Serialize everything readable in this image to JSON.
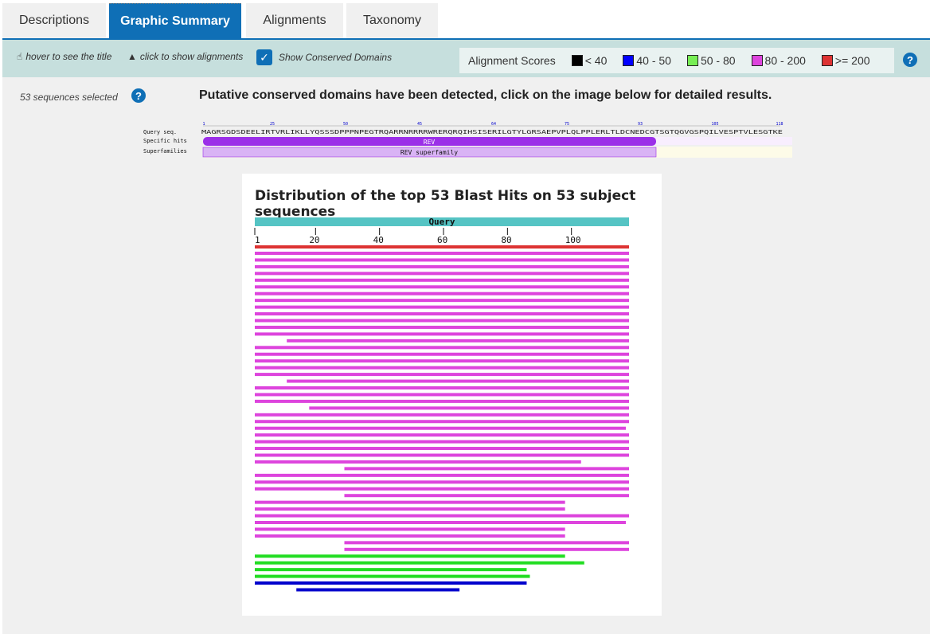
{
  "tabs": [
    "Descriptions",
    "Graphic Summary",
    "Alignments",
    "Taxonomy"
  ],
  "toolbar": {
    "hover_text": "hover to see the title",
    "click_text": "click to show alignments",
    "conserved_label": "Show Conserved Domains",
    "scores_label": "Alignment Scores",
    "score_bins": [
      {
        "label": "< 40",
        "color": "#000000"
      },
      {
        "label": "40 - 50",
        "color": "#0000ff"
      },
      {
        "label": "50 - 80",
        "color": "#77ee55"
      },
      {
        "label": "80 - 200",
        "color": "#dd44dd"
      },
      {
        "label": ">= 200",
        "color": "#dd3333"
      }
    ]
  },
  "selection": {
    "text": "53 sequences selected"
  },
  "message": "Putative conserved domains have been detected, click on the image below for detailed results.",
  "cdd": {
    "query_label": "Query seq.",
    "specific_label": "Specific hits",
    "super_label": "Superfamilies",
    "sequence": "MAGRSGDSDEELIRTVRLIKLLYQSSSDPPPNPEGTRQARRNRRRRWRERQRQIHSISERILGTYLGRSAEPVPLQLPPLERLTLDCNEDCGTSGTQGVGSPQILVESPTVLESGTKE",
    "ticks": [
      "1",
      "25",
      "50",
      "45",
      "64",
      "75",
      "93",
      "105",
      "118"
    ],
    "specific_hit": "REV",
    "superfamily": "REV superfamily"
  },
  "summary": {
    "title": "Distribution of the top 53 Blast Hits on 53 subject sequences",
    "query_label": "Query",
    "axis_ticks": [
      "1",
      "20",
      "40",
      "60",
      "80",
      "100"
    ]
  },
  "colors": {
    "accent": "#0f6fb6",
    "query_bar": "#55c4c4"
  },
  "hits": [
    {
      "s": 1,
      "e": 118,
      "c": "#dd3333"
    },
    {
      "s": 1,
      "e": 118,
      "c": "#dd44dd"
    },
    {
      "s": 1,
      "e": 118,
      "c": "#dd44dd"
    },
    {
      "s": 1,
      "e": 118,
      "c": "#dd44dd"
    },
    {
      "s": 1,
      "e": 118,
      "c": "#dd44dd"
    },
    {
      "s": 1,
      "e": 118,
      "c": "#dd44dd"
    },
    {
      "s": 1,
      "e": 118,
      "c": "#dd44dd"
    },
    {
      "s": 1,
      "e": 118,
      "c": "#dd44dd"
    },
    {
      "s": 1,
      "e": 118,
      "c": "#dd44dd"
    },
    {
      "s": 1,
      "e": 118,
      "c": "#dd44dd"
    },
    {
      "s": 1,
      "e": 118,
      "c": "#dd44dd"
    },
    {
      "s": 1,
      "e": 118,
      "c": "#dd44dd"
    },
    {
      "s": 1,
      "e": 118,
      "c": "#dd44dd"
    },
    {
      "s": 1,
      "e": 118,
      "c": "#dd44dd"
    },
    {
      "s": 11,
      "e": 118,
      "c": "#dd44dd"
    },
    {
      "s": 1,
      "e": 118,
      "c": "#dd44dd"
    },
    {
      "s": 1,
      "e": 118,
      "c": "#dd44dd"
    },
    {
      "s": 1,
      "e": 118,
      "c": "#dd44dd"
    },
    {
      "s": 1,
      "e": 118,
      "c": "#dd44dd"
    },
    {
      "s": 1,
      "e": 118,
      "c": "#dd44dd"
    },
    {
      "s": 11,
      "e": 118,
      "c": "#dd44dd"
    },
    {
      "s": 1,
      "e": 118,
      "c": "#dd44dd"
    },
    {
      "s": 1,
      "e": 118,
      "c": "#dd44dd"
    },
    {
      "s": 1,
      "e": 118,
      "c": "#dd44dd"
    },
    {
      "s": 18,
      "e": 118,
      "c": "#dd44dd"
    },
    {
      "s": 1,
      "e": 118,
      "c": "#dd44dd"
    },
    {
      "s": 1,
      "e": 118,
      "c": "#dd44dd"
    },
    {
      "s": 1,
      "e": 117,
      "c": "#dd44dd"
    },
    {
      "s": 1,
      "e": 118,
      "c": "#dd44dd"
    },
    {
      "s": 1,
      "e": 118,
      "c": "#dd44dd"
    },
    {
      "s": 1,
      "e": 118,
      "c": "#dd44dd"
    },
    {
      "s": 1,
      "e": 118,
      "c": "#dd44dd"
    },
    {
      "s": 1,
      "e": 103,
      "c": "#dd44dd"
    },
    {
      "s": 29,
      "e": 118,
      "c": "#dd44dd"
    },
    {
      "s": 1,
      "e": 118,
      "c": "#dd44dd"
    },
    {
      "s": 1,
      "e": 118,
      "c": "#dd44dd"
    },
    {
      "s": 1,
      "e": 118,
      "c": "#dd44dd"
    },
    {
      "s": 29,
      "e": 118,
      "c": "#dd44dd"
    },
    {
      "s": 1,
      "e": 98,
      "c": "#dd44dd"
    },
    {
      "s": 1,
      "e": 98,
      "c": "#dd44dd"
    },
    {
      "s": 1,
      "e": 118,
      "c": "#dd44dd"
    },
    {
      "s": 1,
      "e": 117,
      "c": "#dd44dd"
    },
    {
      "s": 1,
      "e": 98,
      "c": "#dd44dd"
    },
    {
      "s": 1,
      "e": 98,
      "c": "#dd44dd"
    },
    {
      "s": 29,
      "e": 118,
      "c": "#dd44dd"
    },
    {
      "s": 29,
      "e": 118,
      "c": "#dd44dd"
    },
    {
      "s": 1,
      "e": 98,
      "c": "#22dd22"
    },
    {
      "s": 1,
      "e": 104,
      "c": "#22dd22"
    },
    {
      "s": 1,
      "e": 86,
      "c": "#22dd22"
    },
    {
      "s": 1,
      "e": 87,
      "c": "#22dd22"
    },
    {
      "s": 1,
      "e": 86,
      "c": "#0000cc"
    },
    {
      "s": 14,
      "e": 65,
      "c": "#0000cc"
    }
  ]
}
